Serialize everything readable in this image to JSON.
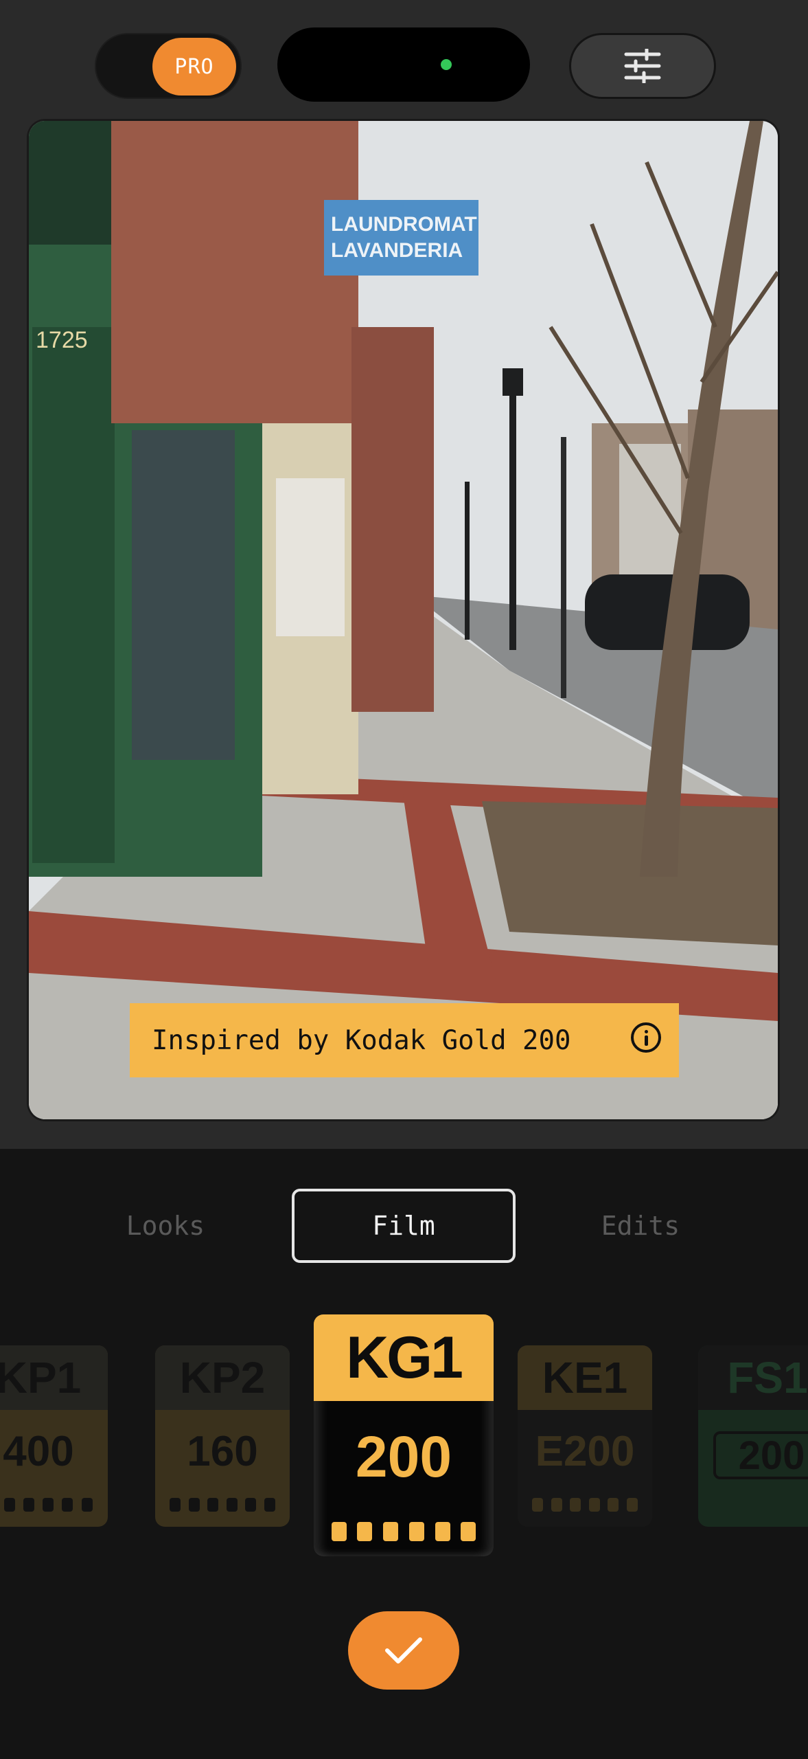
{
  "header": {
    "pro_label": "PRO",
    "adjust_icon": "sliders-icon",
    "status_dot_color": "#34c759"
  },
  "photo": {
    "sign_line1": "LAUNDROMAT",
    "sign_line2": "LAVANDERIA",
    "door_number": "1725"
  },
  "film_banner": {
    "text": "Inspired by Kodak Gold 200",
    "icon": "info-icon"
  },
  "tabs": [
    {
      "label": "Looks",
      "active": false
    },
    {
      "label": "Film",
      "active": true
    },
    {
      "label": "Edits",
      "active": false
    }
  ],
  "films": [
    {
      "code": "KP1",
      "iso": "400",
      "selected": false
    },
    {
      "code": "KP2",
      "iso": "160",
      "selected": false
    },
    {
      "code": "KG1",
      "iso": "200",
      "selected": true
    },
    {
      "code": "KE1",
      "iso": "E200",
      "selected": false
    },
    {
      "code": "FS1",
      "iso": "200",
      "selected": false
    }
  ],
  "confirm": {
    "icon": "checkmark-icon"
  },
  "colors": {
    "accent": "#f08a30",
    "banner": "#f5b74a",
    "fuji_green": "#1f4a2e"
  }
}
